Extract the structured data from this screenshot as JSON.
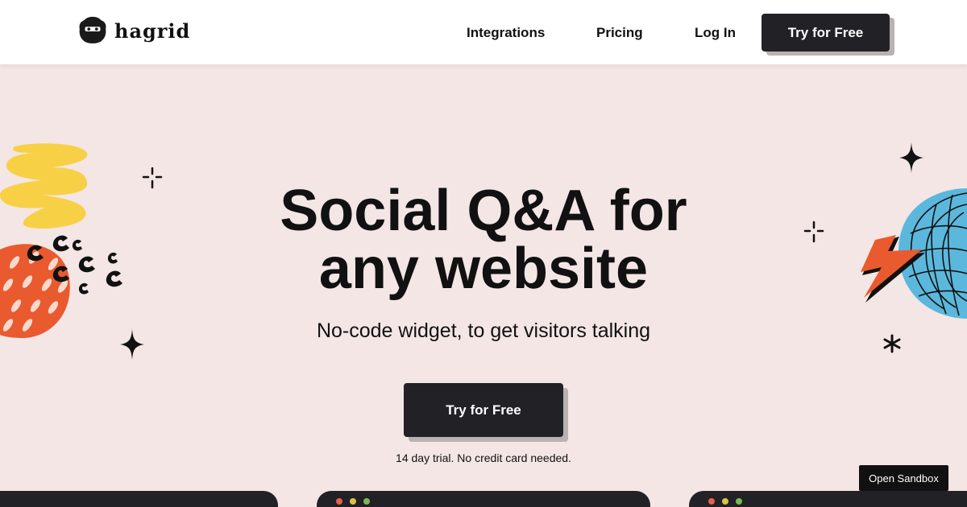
{
  "header": {
    "logo_text": "hagrid",
    "logo_icon": "bearded-face-icon",
    "nav": [
      {
        "label": "Integrations"
      },
      {
        "label": "Pricing"
      },
      {
        "label": "Log In"
      }
    ],
    "cta_label": "Try for Free"
  },
  "hero": {
    "title_line1": "Social Q&A for",
    "title_line2": "any website",
    "subtitle": "No-code widget, to get visitors talking",
    "cta_label": "Try for Free",
    "note": "14 day trial. No credit card needed."
  },
  "sandbox_label": "Open Sandbox",
  "colors": {
    "background": "#f4e6e5",
    "dark": "#222226",
    "yellow": "#f7d046",
    "orange": "#ea5a2f",
    "blue": "#5bb8dc",
    "dot_red": "#e8604c",
    "dot_yellow": "#d9c24a",
    "dot_green": "#7cb955"
  }
}
